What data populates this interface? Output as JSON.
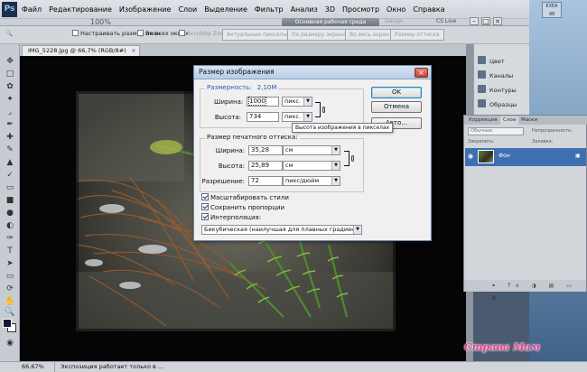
{
  "menubar": {
    "logo": "Ps",
    "items": [
      "Файл",
      "Редактирование",
      "Изображение",
      "Слои",
      "Выделение",
      "Фильтр",
      "Анализ",
      "3D",
      "Просмотр",
      "Окно",
      "Справка"
    ],
    "zoom": "100%",
    "workspace": "Основная рабочая среда",
    "design": "Design",
    "cs_live": "CS Live"
  },
  "options_bar": {
    "resize_windows": "Настраивать размер окон",
    "all_windows": "Во всех окнах",
    "scrubby_zoom": "Scrubby Zoom",
    "actual_pixels": "Актуальные пикселы",
    "fit_screen": "По размеру экрана",
    "fill_screen": "Во весь экран",
    "print_size": "Размер оттиска"
  },
  "document": {
    "tab_title": "IMG_5228.jpg @ 66,7% (RGB/8#)"
  },
  "status": {
    "zoom": "66,67%",
    "info": "Экспозиция работает только в ..."
  },
  "dock": {
    "items": [
      "Цвет",
      "Каналы",
      "Контуры",
      "Образцы"
    ]
  },
  "layers_panel": {
    "tabs": [
      "Коррекция",
      "Слои",
      "Маски"
    ],
    "blend_mode": "Обычные",
    "opacity_label": "Непрозрачность:",
    "lock_label": "Закрепить:",
    "fill_label": "Заливка:",
    "layer_name": "Фон"
  },
  "dialog": {
    "title": "Размер изображения",
    "dimensions_label": "Размерность:",
    "dimensions_value": "2,10M",
    "width_label": "Ширина:",
    "width_value": "1000",
    "width_unit": "пикс.",
    "height_label": "Высота:",
    "height_value": "734",
    "height_unit": "пикс.",
    "ok": "OK",
    "cancel": "Отмена",
    "auto": "Авто...",
    "print_size_label": "Размер печатного оттиска:",
    "print_width_label": "Ширина:",
    "print_width_value": "35,28",
    "print_width_unit": "см",
    "print_height_label": "Высота:",
    "print_height_value": "25,89",
    "print_height_unit": "см",
    "resolution_label": "Разрешение:",
    "resolution_value": "72",
    "resolution_unit": "пикс/дюйм",
    "scale_styles": "Масштабировать стили",
    "constrain": "Сохранить пропорции",
    "resample": "Интерполяция:",
    "resample_method": "Бикубическая (наилучшая для плавных градиентов)",
    "tooltip": "Высота изображения в пикселах"
  },
  "watermark": "Страна Мам",
  "desktop_sign": "EXEA 98"
}
